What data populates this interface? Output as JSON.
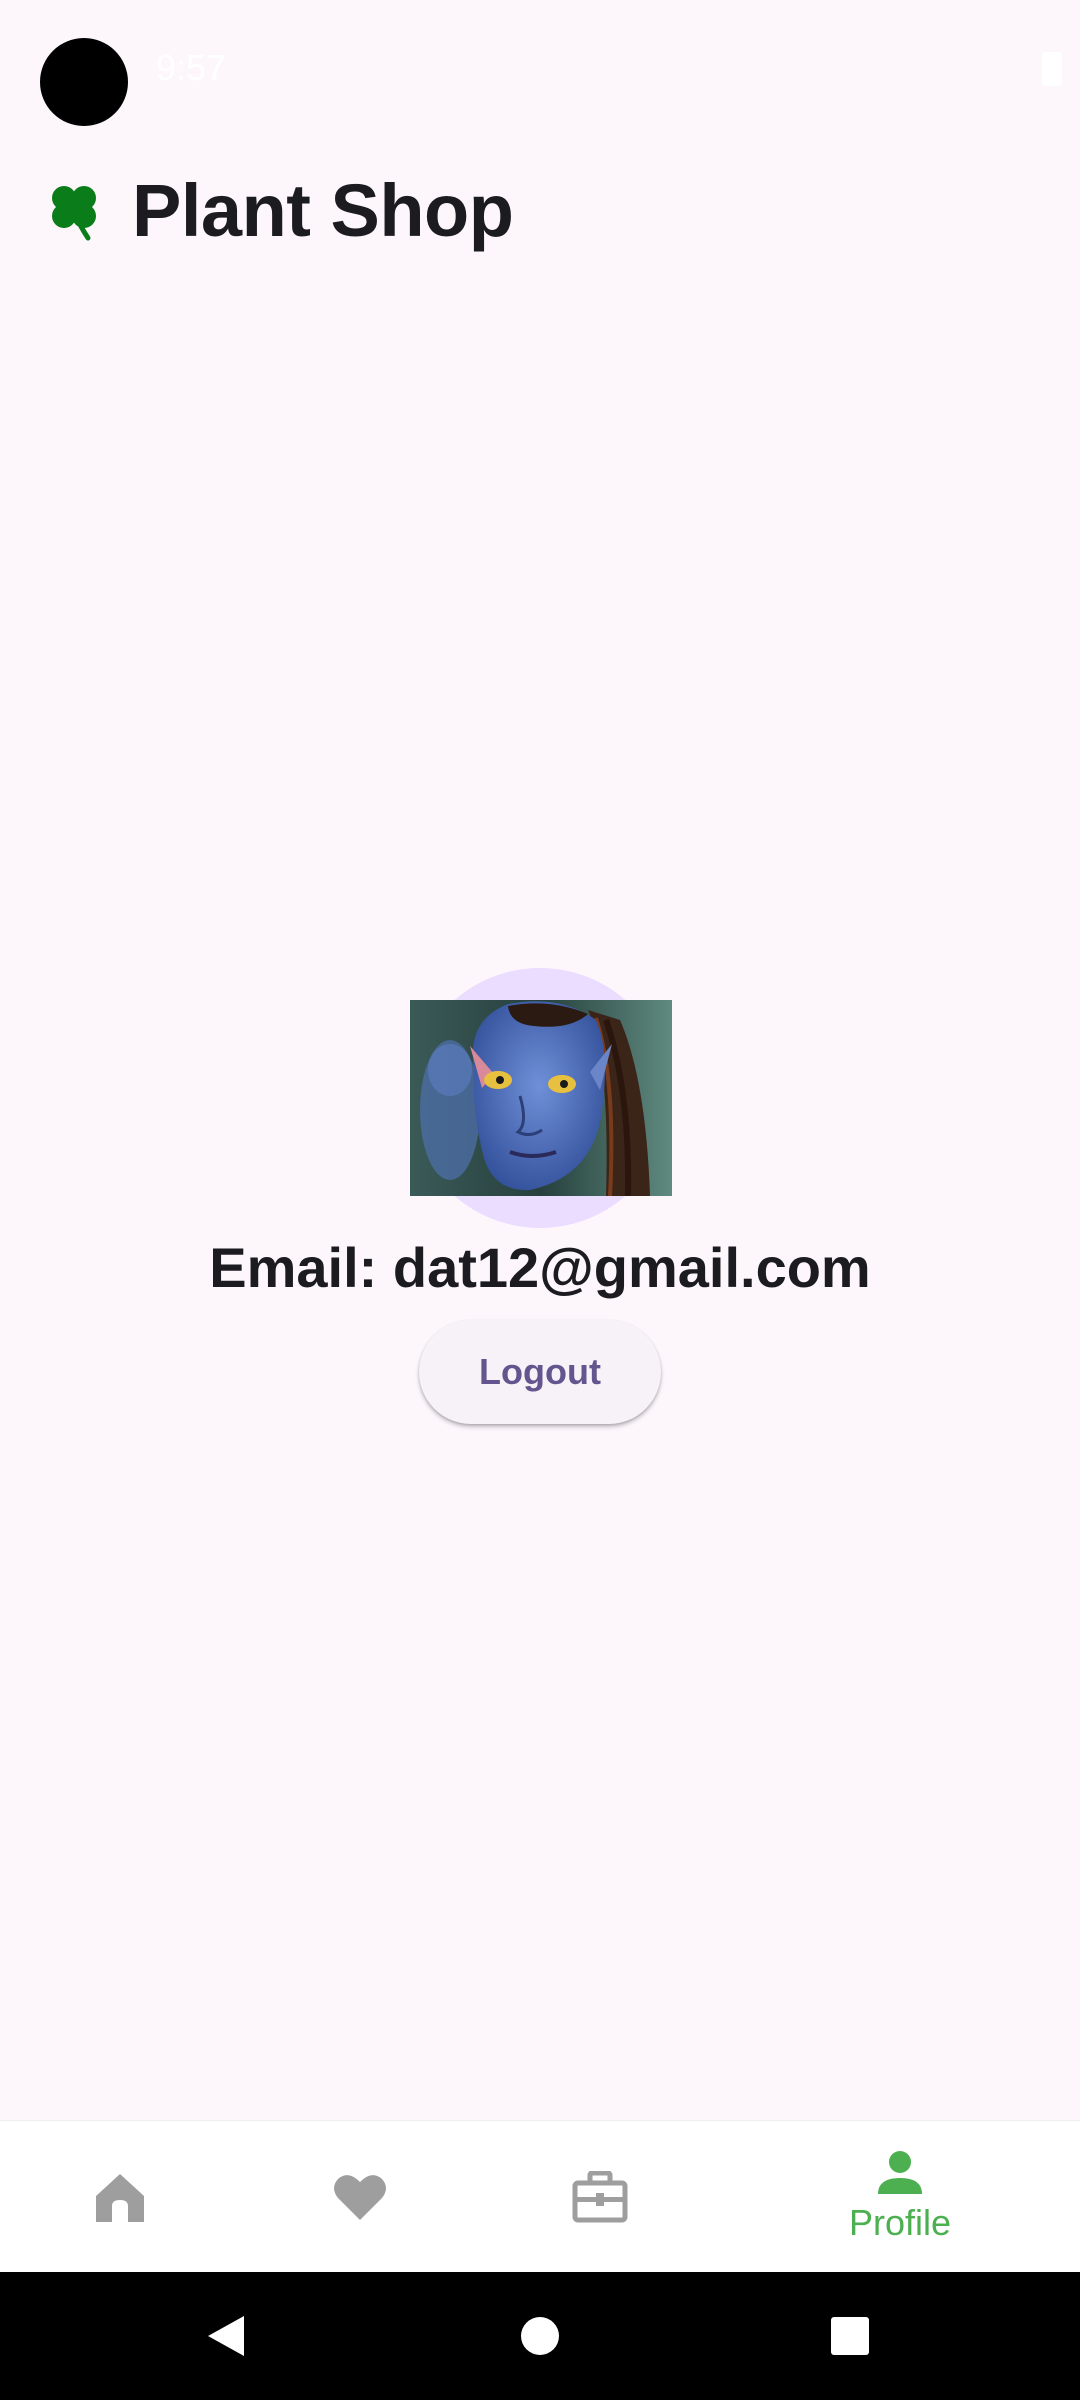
{
  "status_bar": {
    "time": "9:57",
    "icons": [
      "camera-cutout",
      "battery-icon"
    ]
  },
  "header": {
    "title": "Plant Shop",
    "logo_icon": "four-leaf-clover-icon"
  },
  "profile": {
    "avatar_icon": "profile-avatar-photo",
    "email_text": "Email: dat12@gmail.com",
    "logout_label": "Logout"
  },
  "bottom_nav": {
    "items": [
      {
        "icon": "home-icon",
        "label": "",
        "active": false
      },
      {
        "icon": "heart-icon",
        "label": "",
        "active": false
      },
      {
        "icon": "briefcase-icon",
        "label": "",
        "active": false
      },
      {
        "icon": "person-icon",
        "label": "Profile",
        "active": true
      }
    ],
    "inactive_color": "#9e9e9e",
    "active_color": "#4caf50"
  },
  "system_nav": {
    "buttons": [
      "back-icon",
      "home-circle-icon",
      "recents-icon"
    ]
  },
  "colors": {
    "background": "#fdf7fc",
    "title_text": "#1c1b1f",
    "button_text": "#65558f",
    "avatar_background": "#eaddff"
  }
}
